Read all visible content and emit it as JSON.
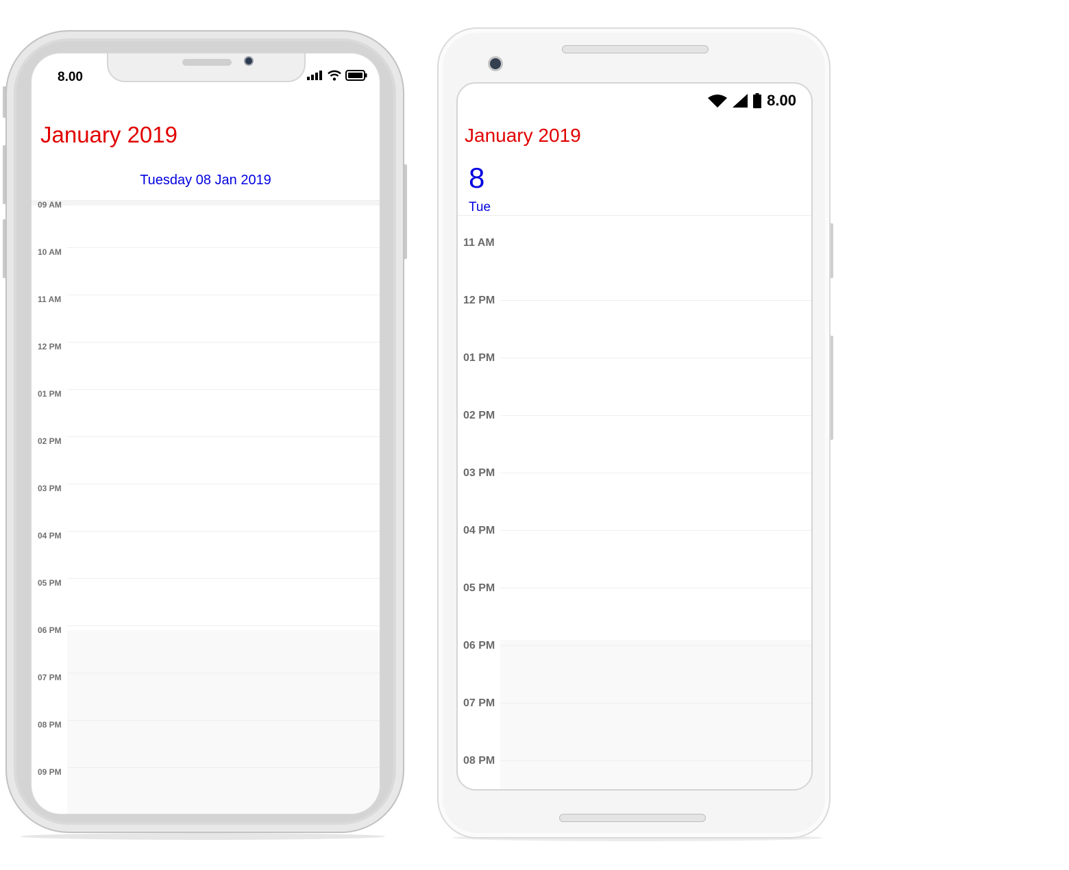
{
  "ios": {
    "status_time": "8.00",
    "month_title": "January 2019",
    "day_header": "Tuesday  08 Jan 2019",
    "time_labels": [
      "09 AM",
      "10 AM",
      "11 AM",
      "12 PM",
      "01 PM",
      "02 PM",
      "03 PM",
      "04 PM",
      "05 PM",
      "06 PM",
      "07 PM",
      "08 PM",
      "09 PM"
    ]
  },
  "android": {
    "status_time": "8.00",
    "month_title": "January 2019",
    "day_number": "8",
    "day_name": "Tue",
    "time_labels": [
      "11 AM",
      "12 PM",
      "01 PM",
      "02 PM",
      "03 PM",
      "04 PM",
      "05 PM",
      "06 PM",
      "07 PM",
      "08 PM"
    ]
  },
  "colors": {
    "month_title": "#e10000",
    "day_header": "#0000e0",
    "time_label": "#6f6f6f",
    "non_working_hours": "#f9f9f9"
  }
}
